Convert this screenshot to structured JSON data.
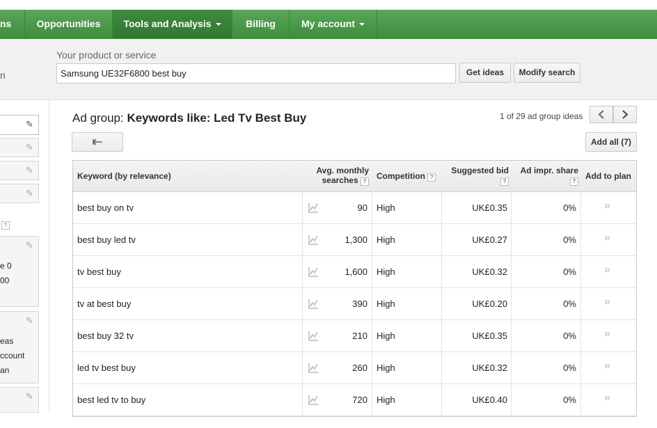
{
  "nav": {
    "items": [
      {
        "label": "ns"
      },
      {
        "label": "Opportunities"
      },
      {
        "label": "Tools and Analysis"
      },
      {
        "label": "Billing"
      },
      {
        "label": "My account"
      }
    ]
  },
  "search": {
    "label": "Your product or service",
    "left_cut_text": "n",
    "value": "Samsung UE32F6800 best buy",
    "get_ideas": "Get ideas",
    "modify_search": "Modify search"
  },
  "sidebar": {
    "q_mark": "?",
    "box2_lines": [
      "e 0",
      "00"
    ],
    "box3_lines": [
      "eas",
      "ccount",
      "an"
    ]
  },
  "main": {
    "adgroup_prefix": "Ad group: ",
    "adgroup_name": "Keywords like: Led Tv Best Buy",
    "pager": "1 of 29 ad group ideas",
    "add_all": "Add all (7)"
  },
  "table": {
    "headers": {
      "keyword": "Keyword (by relevance)",
      "avg_line1": "Avg. monthly",
      "avg_line2": "searches",
      "competition": "Competition",
      "bid": "Suggested bid",
      "share": "Ad impr. share",
      "add": "Add to plan",
      "q": "?"
    },
    "rows": [
      {
        "keyword": "best buy on tv",
        "searches": "90",
        "competition": "High",
        "bid": "UK£0.35",
        "share": "0%"
      },
      {
        "keyword": "best buy led tv",
        "searches": "1,300",
        "competition": "High",
        "bid": "UK£0.27",
        "share": "0%"
      },
      {
        "keyword": "tv best buy",
        "searches": "1,600",
        "competition": "High",
        "bid": "UK£0.32",
        "share": "0%"
      },
      {
        "keyword": "tv at best buy",
        "searches": "390",
        "competition": "High",
        "bid": "UK£0.20",
        "share": "0%"
      },
      {
        "keyword": "best buy 32 tv",
        "searches": "210",
        "competition": "High",
        "bid": "UK£0.35",
        "share": "0%"
      },
      {
        "keyword": "led tv best buy",
        "searches": "260",
        "competition": "High",
        "bid": "UK£0.32",
        "share": "0%"
      },
      {
        "keyword": "best led tv to buy",
        "searches": "720",
        "competition": "High",
        "bid": "UK£0.40",
        "share": "0%"
      }
    ]
  },
  "icons": {
    "pencil": "pencil-icon",
    "trend": "trend-chart-icon",
    "add": "add-to-plan-icon",
    "back": "back-arrow-icon",
    "prev": "chevron-left-icon",
    "next": "chevron-right-icon"
  },
  "colors": {
    "nav_green": "#4a9a4a",
    "nav_active": "#337733"
  }
}
